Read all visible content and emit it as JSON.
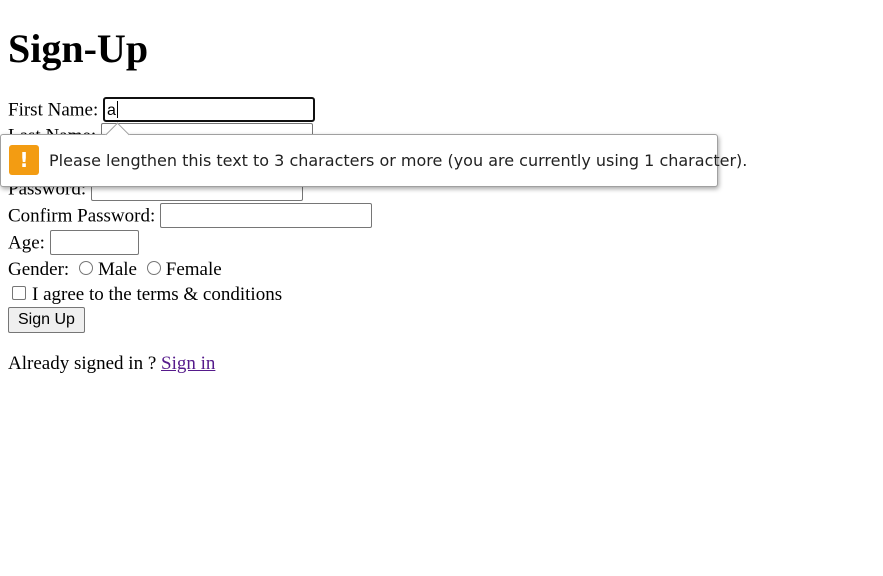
{
  "page": {
    "title": "Sign-Up"
  },
  "form": {
    "first_name_label": "First Name:",
    "first_name_value": "a",
    "last_name_label": "Last Name:",
    "password_label": "Password:",
    "confirm_password_label": "Confirm Password:",
    "age_label": "Age:",
    "gender_label": "Gender:",
    "gender_options": [
      "Male",
      "Female"
    ],
    "terms_label": "I agree to the terms & conditions",
    "submit_label": "Sign Up"
  },
  "footer": {
    "prompt": "Already signed in ? ",
    "link_label": "Sign in"
  },
  "validation": {
    "message": "Please lengthen this text to 3 characters or more (you are currently using 1 character).",
    "icon": "exclamation-warning-icon",
    "icon_color": "#f39c12"
  }
}
